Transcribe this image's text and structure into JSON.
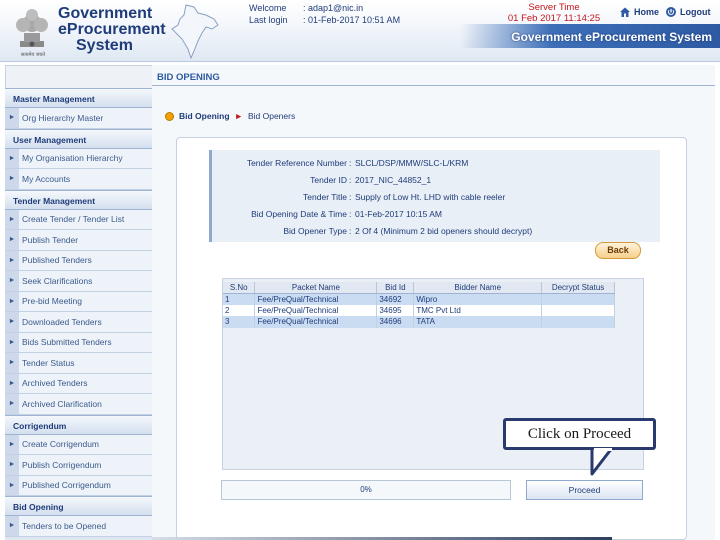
{
  "header": {
    "logo_lines": [
      "Government",
      "eProcurement",
      "System"
    ],
    "emblem_caption": "सत्यमेव जयते",
    "welcome_label": "Welcome",
    "welcome_value": ": adap1@nic.in",
    "last_login_label": "Last login",
    "last_login_value": ": 01-Feb-2017 10:51 AM",
    "server_time_label": "Server Time",
    "server_time_value": "01 Feb 2017 11:14:25",
    "home_label": "Home",
    "logout_label": "Logout",
    "system_title": "Government eProcurement System"
  },
  "sidebar": {
    "sections": [
      {
        "title": "Master Management",
        "items": [
          "Org Hierarchy Master"
        ]
      },
      {
        "title": "User Management",
        "items": [
          "My Organisation Hierarchy",
          "My Accounts"
        ]
      },
      {
        "title": "Tender Management",
        "items": [
          "Create Tender / Tender List",
          "Publish Tender",
          "Published Tenders",
          "Seek Clarifications",
          "Pre-bid Meeting",
          "Downloaded Tenders",
          "Bids Submitted Tenders",
          "Tender Status",
          "Archived Tenders",
          "Archived Clarification"
        ]
      },
      {
        "title": "Corrigendum",
        "items": [
          "Create Corrigendum",
          "Publish Corrigendum",
          "Published Corrigendum"
        ]
      },
      {
        "title": "Bid Opening",
        "items": [
          "Tenders to be Opened"
        ]
      }
    ]
  },
  "main": {
    "page_title": "BID OPENING",
    "breadcrumb": [
      "Bid Opening",
      "Bid Openers"
    ],
    "details": [
      {
        "label": "Tender Reference Number",
        "value": "SLCL/DSP/MMW/SLC-L/KRM"
      },
      {
        "label": "Tender ID",
        "value": "2017_NIC_44852_1"
      },
      {
        "label": "Tender Title",
        "value": "Supply of Low Ht. LHD with cable reeler"
      },
      {
        "label": "Bid Opening Date & Time",
        "value": "01-Feb-2017 10:15 AM"
      },
      {
        "label": "Bid Opener Type",
        "value": "2 Of 4 (Minimum 2 bid openers should decrypt)"
      }
    ],
    "back_label": "Back",
    "table": {
      "columns": [
        "S.No",
        "Packet Name",
        "Bid Id",
        "Bidder Name",
        "Decrypt Status"
      ],
      "rows": [
        [
          "1",
          "Fee/PreQual/Technical",
          "34692",
          "Wipro",
          ""
        ],
        [
          "2",
          "Fee/PreQual/Technical",
          "34695",
          "TMC Pvt Ltd",
          ""
        ],
        [
          "3",
          "Fee/PreQual/Technical",
          "34696",
          "TATA",
          ""
        ]
      ]
    },
    "callout_text": "Click on Proceed",
    "progress_text": "0%",
    "proceed_label": "Proceed"
  }
}
